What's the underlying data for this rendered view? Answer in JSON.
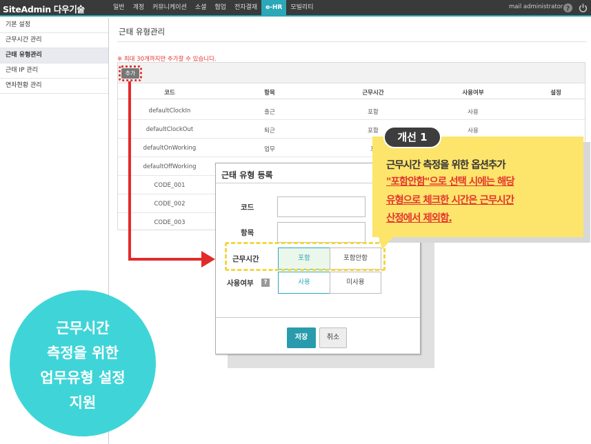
{
  "brand": "SiteAdmin 다우기술",
  "nav": [
    "일반",
    "계정",
    "커뮤니케이션",
    "소셜",
    "협업",
    "전자결재",
    "e-HR",
    "모빌리티"
  ],
  "nav_active": "e-HR",
  "admin": "mail administrator",
  "sidebar": [
    {
      "label": "기본 설정"
    },
    {
      "label": "근무시간 관리"
    },
    {
      "label": "근태 유형관리",
      "active": true
    },
    {
      "label": "근태 IP 관리"
    },
    {
      "label": "연차현황 관리"
    }
  ],
  "page_title": "근태 유형관리",
  "notice": "※ 최대 30개까지만 추가할 수 있습니다.",
  "add_button": "추가",
  "table": {
    "headers": [
      "코드",
      "항목",
      "근무시간",
      "사용여부",
      "설정"
    ],
    "rows": [
      [
        "defaultClockIn",
        "출근",
        "포함",
        "사용",
        ""
      ],
      [
        "defaultClockOut",
        "퇴근",
        "포함",
        "사용",
        ""
      ],
      [
        "defaultOnWorking",
        "업무",
        "포",
        "",
        ""
      ],
      [
        "defaultOffWorking",
        "",
        "",
        "",
        ""
      ],
      [
        "CODE_001",
        "",
        "",
        "",
        ""
      ],
      [
        "CODE_002",
        "",
        "",
        "",
        ""
      ],
      [
        "CODE_003",
        "",
        "",
        "",
        ""
      ]
    ]
  },
  "modal": {
    "title": "근태 유형 등록",
    "code_label": "코드",
    "item_label": "항목",
    "worktime_label": "근무시간",
    "worktime_options": [
      "포함",
      "포함안함"
    ],
    "usage_label": "사용여부",
    "usage_help": "?",
    "usage_options": [
      "사용",
      "미사용"
    ],
    "save": "저장",
    "cancel": "취소"
  },
  "callout": {
    "badge": "개선 1",
    "lines": [
      "근무시간 측정을 위한 옵션추가",
      "\"포함안함\"으로 선택 시에는 해당",
      "유형으로 체크한 시간은 근무시간",
      "산정에서 제외함."
    ]
  },
  "circle_lines": [
    "근무시간",
    "측정을 위한",
    "업무유형 설정",
    "지원"
  ],
  "colors": {
    "accent": "#2aa8b8",
    "highlight": "#fde46b",
    "circle": "#3fd5d8",
    "alert": "#e3342f"
  }
}
